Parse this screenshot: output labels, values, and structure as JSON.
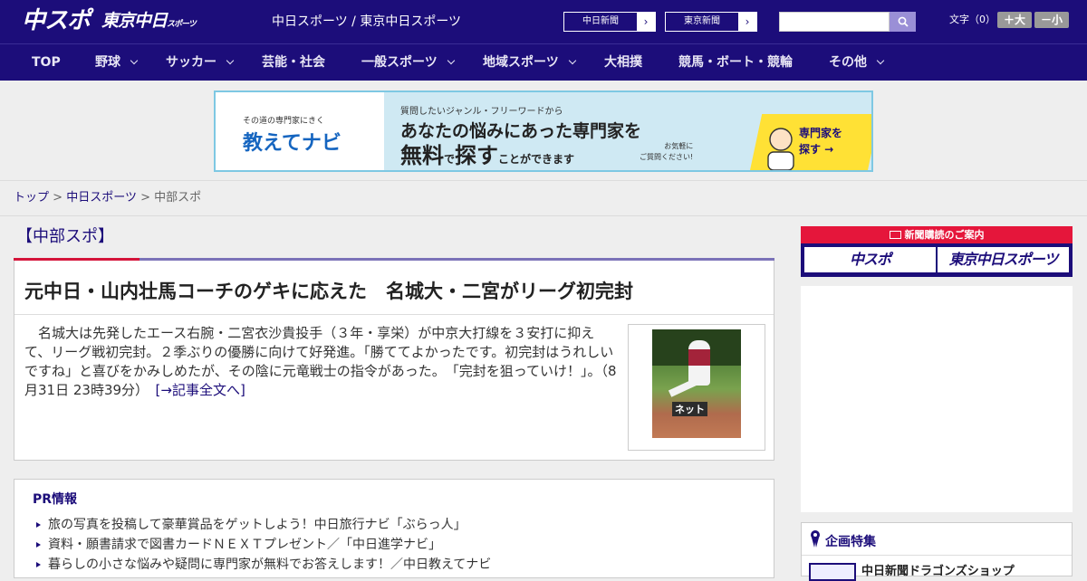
{
  "header": {
    "logo_main": "中スポ",
    "logo_tokyo": "東京中日",
    "logo_tokyo_small": "スポーツ",
    "site_links": "中日スポーツ / 東京中日スポーツ",
    "newspaper_buttons": [
      "中日新聞",
      "東京新聞"
    ],
    "search_placeholder": "",
    "font_size_label": "文字（0）",
    "font_bigger": "＋大",
    "font_smaller": "－小"
  },
  "nav": {
    "items": [
      {
        "label": "TOP",
        "has_dropdown": false
      },
      {
        "label": "野球",
        "has_dropdown": true
      },
      {
        "label": "サッカー",
        "has_dropdown": true
      },
      {
        "label": "芸能・社会",
        "has_dropdown": false
      },
      {
        "label": "一般スポーツ",
        "has_dropdown": true
      },
      {
        "label": "地域スポーツ",
        "has_dropdown": true
      },
      {
        "label": "大相撲",
        "has_dropdown": false
      },
      {
        "label": "競馬・ボート・競輪",
        "has_dropdown": false
      },
      {
        "label": "その他",
        "has_dropdown": true
      }
    ]
  },
  "banner": {
    "brand_sub": "その道の専門家にきく",
    "brand_name": "教えてナビ",
    "line1": "質問したいジャンル・フリーワードから",
    "line2": "あなたの悩みにあった専門家を",
    "line3_a": "無料",
    "line3_b": "で",
    "line3_c": "探す",
    "line3_d": "ことができます",
    "small_text": "お気軽に\nご質問ください!",
    "cta": "専門家を\n探す →"
  },
  "breadcrumb": {
    "top": "トップ",
    "section": "中日スポーツ",
    "current": "中部スポ",
    "separator": ">"
  },
  "category": {
    "title": "【中部スポ】"
  },
  "article": {
    "title": "元中日・山内壮馬コーチのゲキに応えた　名城大・二宮がリーグ初完封",
    "body": "名城大は先発したエース右腕・二宮衣沙貴投手（３年・享栄）が中京大打線を３安打に抑えて、リーグ戦初完封。２季ぶりの優勝に向けて好発進。「勝ててよかったです。初完封はうれしいですね」と喜びをかみしめたが、その陰に元竜戦士の指令があった。　「完封を狙っていけ！」。（8月31日 23時39分）　",
    "more_link": "[→記事全文へ]",
    "photo_caption": "ネット"
  },
  "pr": {
    "title": "PR情報",
    "items": [
      "旅の写真を投稿して豪華賞品をゲットしよう！中日旅行ナビ「ぶらっ人」",
      "資料・願書請求で図書カードＮＥＸＴプレゼント／「中日進学ナビ」",
      "暮らしの小さな悩みや疑問に専門家が無料でお答えします！／中日教えてナビ"
    ]
  },
  "sidebar": {
    "subscription_head": "新聞購読のご案内",
    "subscription_buttons": [
      "中スポ",
      "東京中日スポーツ"
    ],
    "feature_title": "企画特集",
    "feature_item": "中日新聞ドラゴンズショップ"
  },
  "colors": {
    "brand_navy": "#1c0d7a",
    "accent_red": "#d4143a",
    "banner_blue": "#cfe9f3",
    "cta_yellow": "#ffe135"
  }
}
